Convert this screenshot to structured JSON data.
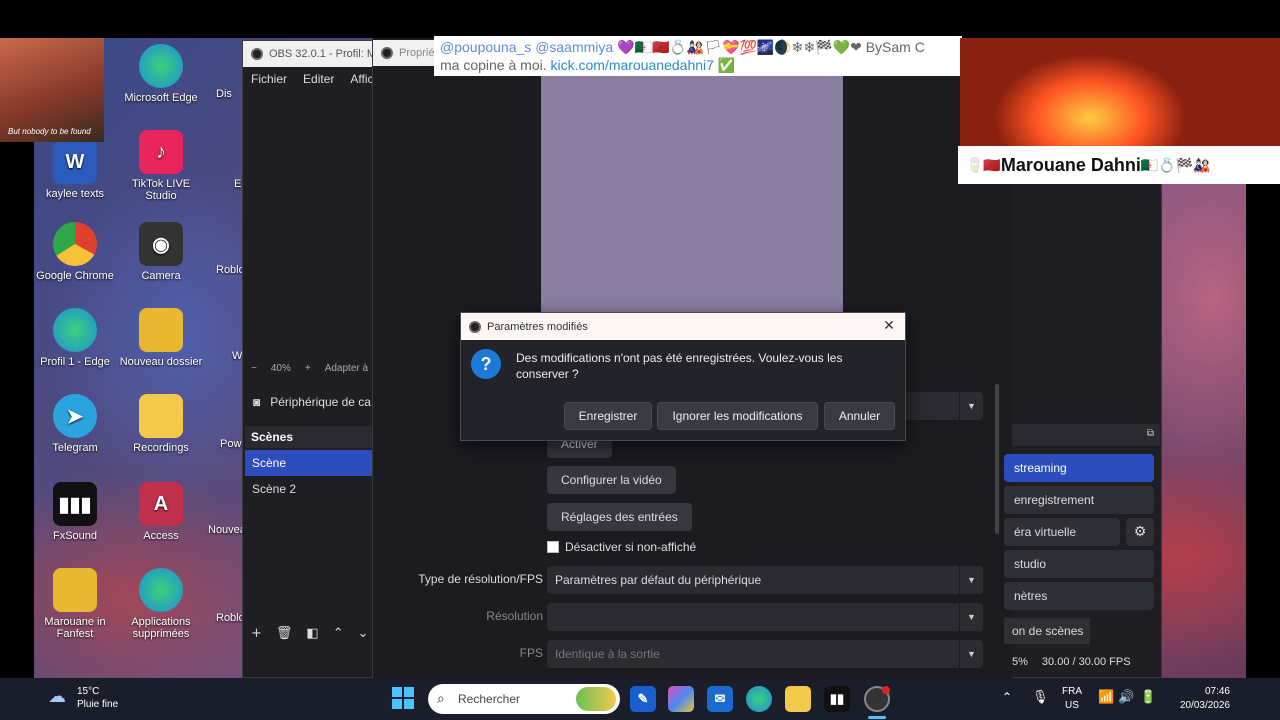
{
  "desktop_icons": [
    {
      "label": "Microsoft Edge",
      "icon": "edge-icon",
      "color": "#1b8fd8"
    },
    {
      "label": "kaylee texts",
      "icon": "word-icon",
      "color": "#2b5cbd"
    },
    {
      "label": "TikTok LIVE Studio",
      "icon": "tiktok-icon",
      "color": "#e8245a"
    },
    {
      "label": "Google Chrome",
      "icon": "chrome-icon",
      "color": "#e04030"
    },
    {
      "label": "Camera",
      "icon": "camera-icon",
      "color": "#333333"
    },
    {
      "label": "Profil 1 - Edge",
      "icon": "edge-icon",
      "color": "#1b8fd8"
    },
    {
      "label": "Nouveau dossier",
      "icon": "folder-icon",
      "color": "#e8b830"
    },
    {
      "label": "Telegram",
      "icon": "telegram-icon",
      "color": "#2aa3de"
    },
    {
      "label": "Recordings",
      "icon": "folder-icon",
      "color": "#f3c94a"
    },
    {
      "label": "FxSound",
      "icon": "fxsound-icon",
      "color": "#111111"
    },
    {
      "label": "Access",
      "icon": "access-icon",
      "color": "#c0304a"
    },
    {
      "label": "Marouane in Fanfest",
      "icon": "folder-icon",
      "color": "#e8b830"
    },
    {
      "label": "Applications supprimées",
      "icon": "edge-icon",
      "color": "#1b8fd8"
    }
  ],
  "partial_icons": [
    "Dis",
    "E",
    "Roblo",
    "W",
    "Pow",
    "Nouvea",
    "Roblo"
  ],
  "obs": {
    "title": "OBS 32.0.1 - Profil: Ma",
    "menu": [
      "Fichier",
      "Editer",
      "Affich"
    ],
    "zoom": "40%",
    "zoom_minus": "−",
    "zoom_plus": "+",
    "fit": "Adapter à",
    "source": "Périphérique de ca",
    "scenes_header": "Scènes",
    "scenes": [
      "Scène",
      "Scène 2"
    ]
  },
  "props": {
    "title": "Propriét",
    "activate": "Activer",
    "configure_video": "Configurer la vidéo",
    "input_settings": "Réglages des entrées",
    "disable_hidden": "Désactiver si non-affiché",
    "res_type_label": "Type de résolution/FPS",
    "res_type_value": "Paramètres par défaut du périphérique",
    "resolution_label": "Résolution",
    "resolution_value": "",
    "fps_label": "FPS",
    "fps_value": "Identique à la sortie"
  },
  "controls": {
    "streaming": "streaming",
    "recording": "enregistrement",
    "virtual_cam": "éra virtuelle",
    "studio": "studio",
    "settings": "nètres",
    "transitions": "on de scènes",
    "stats_pct": "5%",
    "stats_fps": "30.00 / 30.00 FPS"
  },
  "dialog": {
    "title": "Paramètres modifiés",
    "message": "Des modifications n'ont pas été enregistrées. Voulez-vous les conserver ?",
    "save": "Enregistrer",
    "ignore": "Ignorer les modifications",
    "cancel": "Annuler"
  },
  "chat": {
    "mention1": "@poupouna_s",
    "mention2": "@saammiya",
    "emojis": "💜🇩🇿🇲🇦💍🎎🏳💝💯🌌🌒❄❄🏁💚❤",
    "tail": "BySam C",
    "line2": "ma copine à moi.",
    "link": "kick.com/marouanedahni7",
    "verified": "✅"
  },
  "webcam_caption": "But nobody to be found",
  "name_bar": {
    "name": "Marouane Dahni",
    "prefix": "🥛🇲🇦",
    "suffix": "🇩🇿💍🏁🎎"
  },
  "taskbar": {
    "temp": "15°C",
    "weather": "Pluie fine",
    "search": "Rechercher",
    "lang1": "FRA",
    "lang2": "US",
    "time": "07:46",
    "date": "20/03/2026"
  }
}
